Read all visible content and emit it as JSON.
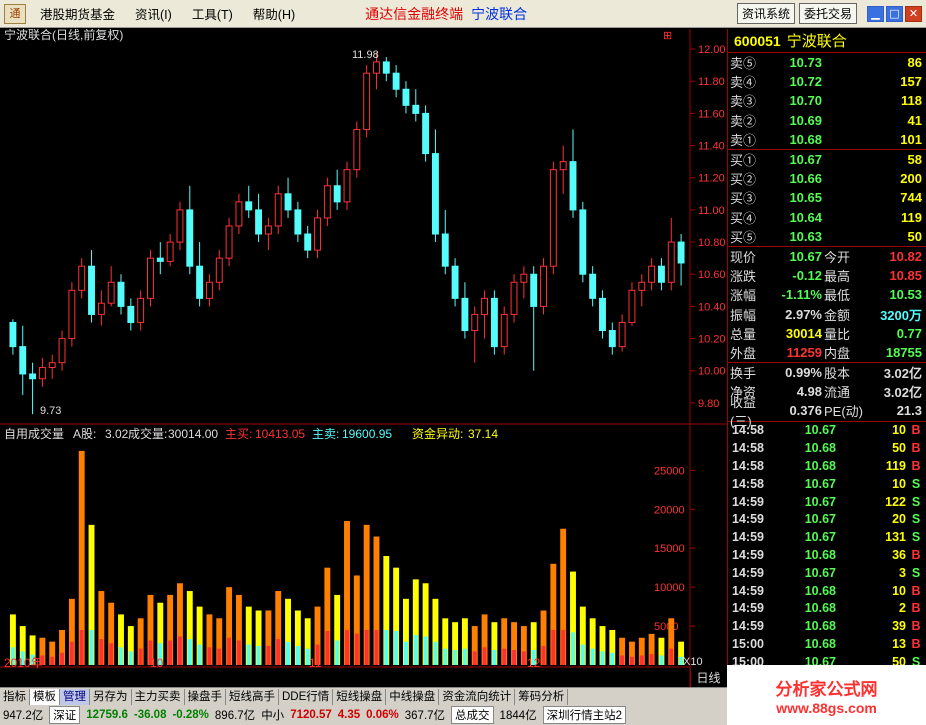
{
  "menu": {
    "logo_icon": "app-logo-icon",
    "items": [
      "港股期货基金",
      "资讯(I)",
      "工具(T)",
      "帮助(H)"
    ],
    "title_red": "通达信金融终端",
    "title_blue": "宁波联合",
    "buttons": [
      "资讯系统",
      "委托交易"
    ],
    "window_buttons": [
      "▁",
      "□",
      "✕"
    ]
  },
  "chart_header": {
    "title": "宁波联合(日线,前复权)",
    "high_label": "11.98",
    "low_label": "9.73",
    "icon": "chart-settings-icon"
  },
  "volume_header": {
    "label": "自用成交量",
    "a_label": "A股:",
    "a_value": "3.02",
    "vol_label": "成交量:",
    "vol_value": "30014.00",
    "buy_label": "主买:",
    "buy_value": "10413.05",
    "sell_label": "主卖:",
    "sell_value": "19600.95",
    "flow_label": "资金异动:",
    "flow_value": "37.14"
  },
  "x_axis_labels": [
    "2010年",
    "10",
    "11",
    "12"
  ],
  "price_axis": [
    "12.00",
    "11.80",
    "11.60",
    "11.40",
    "11.20",
    "11.00",
    "10.80",
    "10.60",
    "10.40",
    "10.20",
    "10.00",
    "9.80"
  ],
  "volume_axis": [
    "25000",
    "20000",
    "15000",
    "10000",
    "5000"
  ],
  "volume_multiplier": "X10",
  "period": "日线",
  "chart_data": {
    "type": "candlestick",
    "ylim": [
      9.7,
      12.05
    ],
    "ohlc": [
      [
        10.3,
        10.32,
        10.1,
        10.15
      ],
      [
        10.15,
        10.28,
        9.85,
        9.98
      ],
      [
        9.98,
        10.05,
        9.73,
        9.95
      ],
      [
        9.95,
        10.08,
        9.9,
        10.02
      ],
      [
        10.02,
        10.1,
        9.95,
        10.05
      ],
      [
        10.05,
        10.25,
        10.0,
        10.2
      ],
      [
        10.2,
        10.55,
        10.15,
        10.5
      ],
      [
        10.5,
        10.7,
        10.45,
        10.65
      ],
      [
        10.65,
        10.75,
        10.3,
        10.35
      ],
      [
        10.35,
        10.5,
        10.28,
        10.42
      ],
      [
        10.42,
        10.65,
        10.4,
        10.55
      ],
      [
        10.55,
        10.6,
        10.35,
        10.4
      ],
      [
        10.4,
        10.45,
        10.25,
        10.3
      ],
      [
        10.3,
        10.5,
        10.25,
        10.45
      ],
      [
        10.45,
        10.75,
        10.4,
        10.7
      ],
      [
        10.7,
        10.8,
        10.6,
        10.68
      ],
      [
        10.68,
        10.85,
        10.65,
        10.8
      ],
      [
        10.8,
        11.05,
        10.75,
        11.0
      ],
      [
        11.0,
        11.15,
        10.6,
        10.65
      ],
      [
        10.65,
        10.8,
        10.4,
        10.45
      ],
      [
        10.45,
        10.6,
        10.4,
        10.55
      ],
      [
        10.55,
        10.75,
        10.5,
        10.7
      ],
      [
        10.7,
        10.95,
        10.65,
        10.9
      ],
      [
        10.9,
        11.1,
        10.85,
        11.05
      ],
      [
        11.05,
        11.15,
        10.95,
        11.0
      ],
      [
        11.0,
        11.1,
        10.8,
        10.85
      ],
      [
        10.85,
        10.95,
        10.75,
        10.9
      ],
      [
        10.9,
        11.15,
        10.85,
        11.1
      ],
      [
        11.1,
        11.2,
        10.95,
        11.0
      ],
      [
        11.0,
        11.05,
        10.8,
        10.85
      ],
      [
        10.85,
        10.9,
        10.7,
        10.75
      ],
      [
        10.75,
        11.0,
        10.7,
        10.95
      ],
      [
        10.95,
        11.2,
        10.9,
        11.15
      ],
      [
        11.15,
        11.25,
        11.0,
        11.05
      ],
      [
        11.05,
        11.3,
        11.0,
        11.25
      ],
      [
        11.25,
        11.55,
        11.2,
        11.5
      ],
      [
        11.5,
        11.9,
        11.45,
        11.85
      ],
      [
        11.85,
        11.98,
        11.75,
        11.92
      ],
      [
        11.92,
        11.95,
        11.8,
        11.85
      ],
      [
        11.85,
        11.9,
        11.7,
        11.75
      ],
      [
        11.75,
        11.8,
        11.6,
        11.65
      ],
      [
        11.65,
        11.75,
        11.55,
        11.6
      ],
      [
        11.6,
        11.65,
        11.3,
        11.35
      ],
      [
        11.35,
        11.5,
        10.8,
        10.85
      ],
      [
        10.85,
        11.0,
        10.6,
        10.65
      ],
      [
        10.65,
        10.7,
        10.4,
        10.45
      ],
      [
        10.45,
        10.55,
        10.2,
        10.25
      ],
      [
        10.25,
        10.4,
        10.05,
        10.35
      ],
      [
        10.35,
        10.5,
        10.2,
        10.45
      ],
      [
        10.45,
        10.5,
        10.1,
        10.15
      ],
      [
        10.15,
        10.4,
        10.1,
        10.35
      ],
      [
        10.35,
        10.6,
        10.3,
        10.55
      ],
      [
        10.55,
        10.65,
        10.45,
        10.6
      ],
      [
        10.6,
        10.65,
        10.0,
        10.4
      ],
      [
        10.4,
        10.7,
        10.35,
        10.65
      ],
      [
        10.65,
        11.3,
        10.6,
        11.25
      ],
      [
        11.25,
        11.4,
        11.1,
        11.3
      ],
      [
        11.3,
        11.5,
        10.95,
        11.0
      ],
      [
        11.0,
        11.05,
        10.55,
        10.6
      ],
      [
        10.6,
        10.65,
        10.4,
        10.45
      ],
      [
        10.45,
        10.5,
        10.2,
        10.25
      ],
      [
        10.25,
        10.3,
        10.1,
        10.15
      ],
      [
        10.15,
        10.35,
        10.12,
        10.3
      ],
      [
        10.3,
        10.55,
        10.28,
        10.5
      ],
      [
        10.5,
        10.6,
        10.4,
        10.55
      ],
      [
        10.55,
        10.7,
        10.5,
        10.65
      ],
      [
        10.65,
        10.7,
        10.5,
        10.55
      ],
      [
        10.55,
        10.95,
        10.5,
        10.8
      ],
      [
        10.8,
        10.85,
        10.53,
        10.67
      ]
    ],
    "volume": [
      6500,
      5000,
      3800,
      3500,
      3000,
      4500,
      8500,
      27500,
      18000,
      9500,
      8000,
      6500,
      5000,
      6000,
      9000,
      8000,
      9000,
      10500,
      9500,
      7500,
      6500,
      6000,
      10000,
      9000,
      7500,
      7000,
      7000,
      9500,
      8500,
      7000,
      6000,
      7500,
      12500,
      9000,
      18500,
      11500,
      18000,
      16500,
      14000,
      12500,
      8500,
      11000,
      10500,
      8500,
      6000,
      5500,
      6000,
      5000,
      6500,
      5500,
      6000,
      5500,
      5000,
      5500,
      7000,
      13000,
      17500,
      12000,
      7500,
      6000,
      5000,
      4500,
      3500,
      3000,
      3500,
      4000,
      3500,
      6000,
      3000
    ],
    "up_color": "#ff3232",
    "down_color": "#54fcfc",
    "volume_colors": [
      "#ffff00",
      "#ff8000",
      "#ff3232",
      "#54fcfc"
    ]
  },
  "quote": {
    "code": "600051",
    "name": "宁波联合",
    "sell": [
      {
        "label": "卖⑤",
        "price": "10.73",
        "vol": "86"
      },
      {
        "label": "卖④",
        "price": "10.72",
        "vol": "157"
      },
      {
        "label": "卖③",
        "price": "10.70",
        "vol": "118"
      },
      {
        "label": "卖②",
        "price": "10.69",
        "vol": "41"
      },
      {
        "label": "卖①",
        "price": "10.68",
        "vol": "101"
      }
    ],
    "buy": [
      {
        "label": "买①",
        "price": "10.67",
        "vol": "58"
      },
      {
        "label": "买②",
        "price": "10.66",
        "vol": "200"
      },
      {
        "label": "买③",
        "price": "10.65",
        "vol": "744"
      },
      {
        "label": "买④",
        "price": "10.64",
        "vol": "119"
      },
      {
        "label": "买⑤",
        "price": "10.63",
        "vol": "50"
      }
    ],
    "stats1": [
      {
        "l": "现价",
        "v": "10.67",
        "vc": "#54fc54",
        "l2": "今开",
        "v2": "10.82",
        "v2c": "#ff3232"
      },
      {
        "l": "涨跌",
        "v": "-0.12",
        "vc": "#54fc54",
        "l2": "最高",
        "v2": "10.85",
        "v2c": "#ff3232"
      },
      {
        "l": "涨幅",
        "v": "-1.11%",
        "vc": "#54fc54",
        "l2": "最低",
        "v2": "10.53",
        "v2c": "#54fc54"
      },
      {
        "l": "振幅",
        "v": "2.97%",
        "vc": "#dddddd",
        "l2": "金额",
        "v2": "3200万",
        "v2c": "#54fcfc"
      },
      {
        "l": "总量",
        "v": "30014",
        "vc": "#ffff00",
        "l2": "量比",
        "v2": "0.77",
        "v2c": "#54fc54"
      },
      {
        "l": "外盘",
        "v": "11259",
        "vc": "#ff3232",
        "l2": "内盘",
        "v2": "18755",
        "v2c": "#54fc54"
      }
    ],
    "stats2": [
      {
        "l": "换手",
        "v": "0.99%",
        "vc": "#dddddd",
        "l2": "股本",
        "v2": "3.02亿",
        "v2c": "#dddddd"
      },
      {
        "l": "净资",
        "v": "4.98",
        "vc": "#dddddd",
        "l2": "流通",
        "v2": "3.02亿",
        "v2c": "#dddddd"
      },
      {
        "l": "收益(三)",
        "v": "0.376",
        "vc": "#dddddd",
        "l2": "PE(动)",
        "v2": "21.3",
        "v2c": "#dddddd"
      }
    ],
    "ticks": [
      {
        "t": "14:58",
        "p": "10.67",
        "v": "10",
        "d": "B"
      },
      {
        "t": "14:58",
        "p": "10.68",
        "v": "50",
        "d": "B"
      },
      {
        "t": "14:58",
        "p": "10.68",
        "v": "119",
        "d": "B"
      },
      {
        "t": "14:58",
        "p": "10.67",
        "v": "10",
        "d": "S"
      },
      {
        "t": "14:59",
        "p": "10.67",
        "v": "122",
        "d": "S"
      },
      {
        "t": "14:59",
        "p": "10.67",
        "v": "20",
        "d": "S"
      },
      {
        "t": "14:59",
        "p": "10.67",
        "v": "131",
        "d": "S"
      },
      {
        "t": "14:59",
        "p": "10.68",
        "v": "36",
        "d": "B"
      },
      {
        "t": "14:59",
        "p": "10.67",
        "v": "3",
        "d": "S"
      },
      {
        "t": "14:59",
        "p": "10.68",
        "v": "10",
        "d": "B"
      },
      {
        "t": "14:59",
        "p": "10.68",
        "v": "2",
        "d": "B"
      },
      {
        "t": "14:59",
        "p": "10.68",
        "v": "39",
        "d": "B"
      },
      {
        "t": "15:00",
        "p": "10.68",
        "v": "13",
        "d": "B"
      },
      {
        "t": "15:00",
        "p": "10.67",
        "v": "50",
        "d": "S"
      }
    ]
  },
  "tabs": [
    "指标",
    "模板",
    "管理",
    "另存为",
    "主力买卖",
    "操盘手",
    "短线高手",
    "DDE行情",
    "短线操盘",
    "中线操盘",
    "资金流向统计",
    "筹码分析"
  ],
  "status": {
    "p1": "947.2亿",
    "index": "深证",
    "idx_val": "12759.6",
    "idx_chg": "-36.08",
    "idx_pct": "-0.28%",
    "amt": "896.7亿",
    "sme": "中小",
    "sme_val": "7120.57",
    "sme_chg": "4.35",
    "sme_pct": "0.06%",
    "sme_amt": "367.7亿",
    "f1": "总成交",
    "f2": "1844亿",
    "f3": "深圳行情主站2"
  },
  "brand": {
    "title": "分析家公式网",
    "url": "www.88gs.com"
  }
}
